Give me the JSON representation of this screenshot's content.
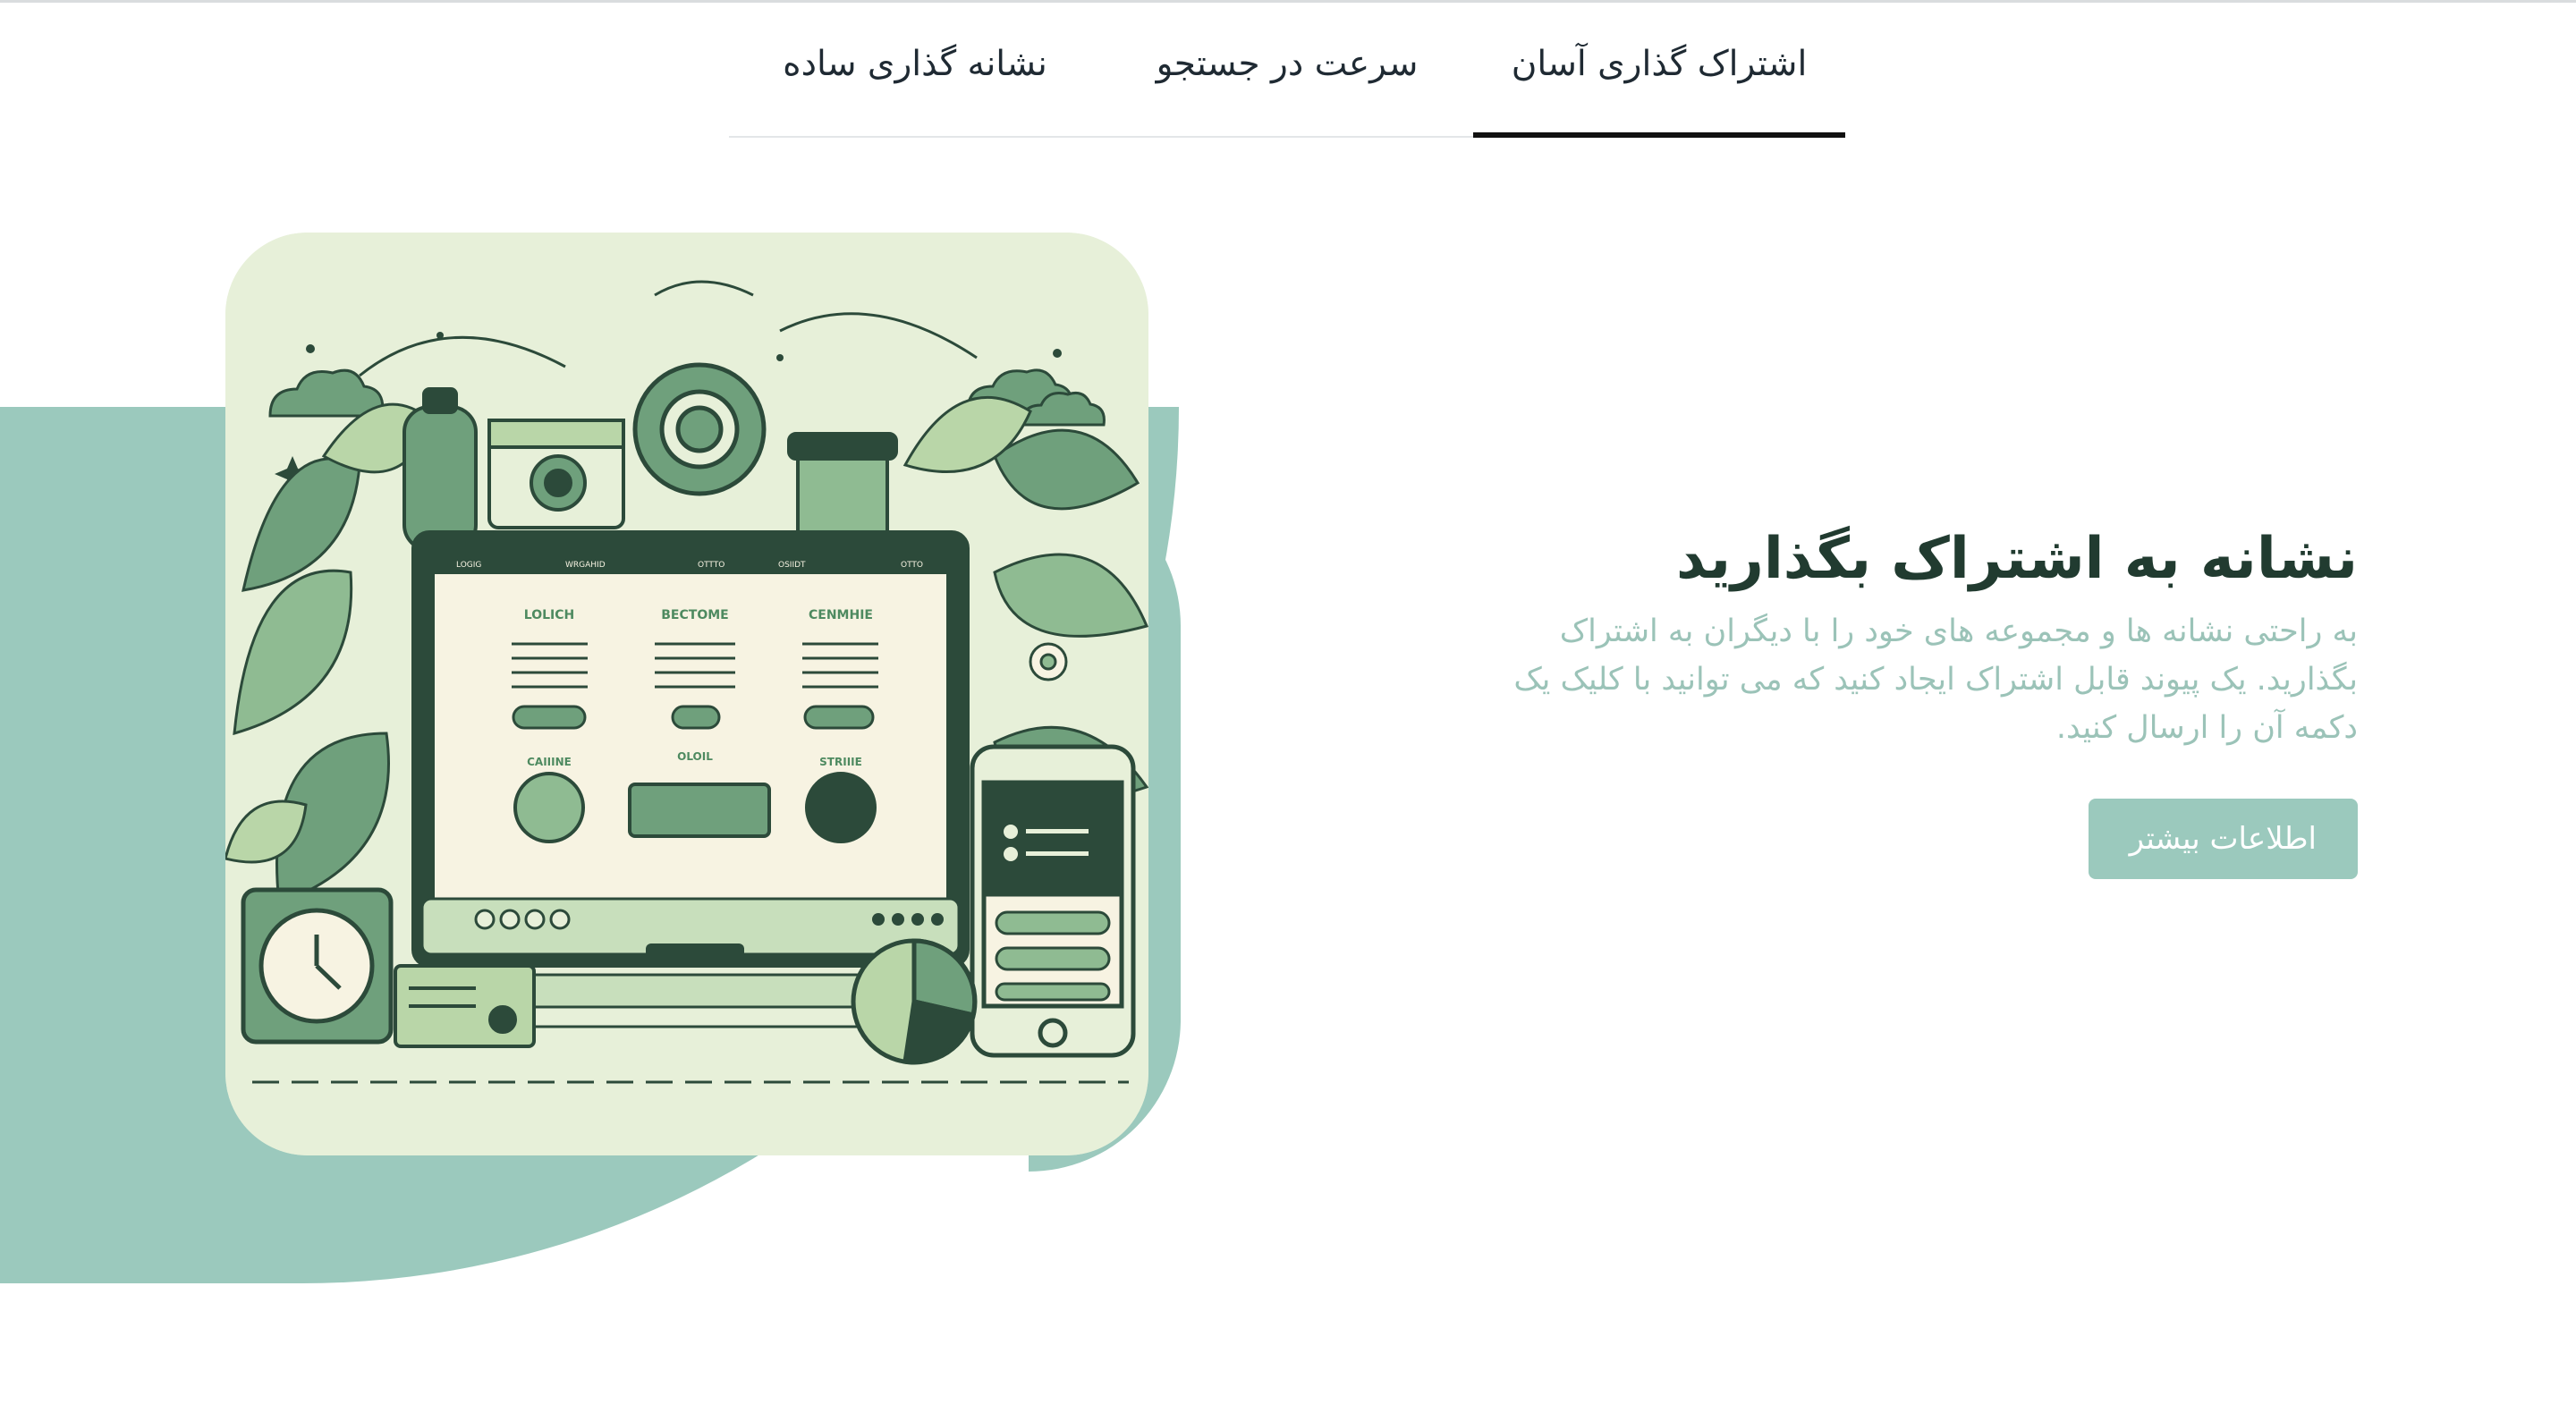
{
  "tabs": [
    {
      "label": "اشتراک گذاری آسان",
      "active": true
    },
    {
      "label": "سرعت در جستجو",
      "active": false
    },
    {
      "label": "نشانه گذاری ساده",
      "active": false
    }
  ],
  "hero": {
    "title": "نشانه به اشتراک بگذارید",
    "description": "به راحتی نشانه ها و مجموعه های خود را با دیگران به اشتراک بگذارید. یک پیوند قابل اشتراک ایجاد کنید که می توانید با کلیک یک دکمه آن را ارسال کنید.",
    "button_label": "اطلاعات بیشتر"
  },
  "illustration": {
    "screen_headers": [
      "LOLICH",
      "BECTOME",
      "CENMHIE"
    ],
    "screen_labels": [
      "CAIIINE",
      "OLOIL",
      "STRIIIE"
    ],
    "screen_nav": [
      "LOGIG",
      "WRGAHID",
      "OTTTO",
      "OSIIDT",
      "OTTO"
    ]
  },
  "colors": {
    "accent": "#9bc9bd",
    "title": "#213b30",
    "description": "#9bc3b8",
    "illustration_bg": "#e7f0d9",
    "illustration_dark": "#2c4a3a",
    "illustration_mid": "#6fa07c"
  }
}
